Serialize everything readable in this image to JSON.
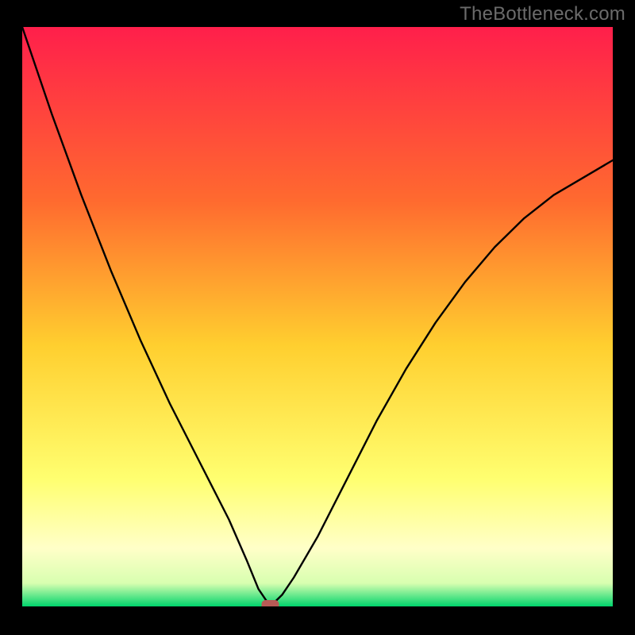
{
  "watermark": "TheBottleneck.com",
  "chart_data": {
    "type": "line",
    "title": "",
    "xlabel": "",
    "ylabel": "",
    "xlim": [
      0,
      100
    ],
    "ylim": [
      0,
      100
    ],
    "grid": false,
    "legend": false,
    "background_gradient": {
      "top": "#ff1f4b",
      "mid_upper": "#ff9a2b",
      "mid": "#ffe43a",
      "lower": "#ffff9a",
      "bottom": "#00d46c"
    },
    "curve": {
      "description": "V-shaped bottleneck curve with minimum near x≈42",
      "min_x": 42,
      "x": [
        0,
        5,
        10,
        15,
        20,
        25,
        30,
        35,
        38,
        40,
        42,
        44,
        46,
        50,
        55,
        60,
        65,
        70,
        75,
        80,
        85,
        90,
        95,
        100
      ],
      "y": [
        100,
        85,
        71,
        58,
        46,
        35,
        25,
        15,
        8,
        3,
        0,
        2,
        5,
        12,
        22,
        32,
        41,
        49,
        56,
        62,
        67,
        71,
        74,
        77
      ]
    },
    "marker": {
      "x": 42,
      "y": 0,
      "color": "#b85a56",
      "shape": "rounded-rect"
    }
  }
}
